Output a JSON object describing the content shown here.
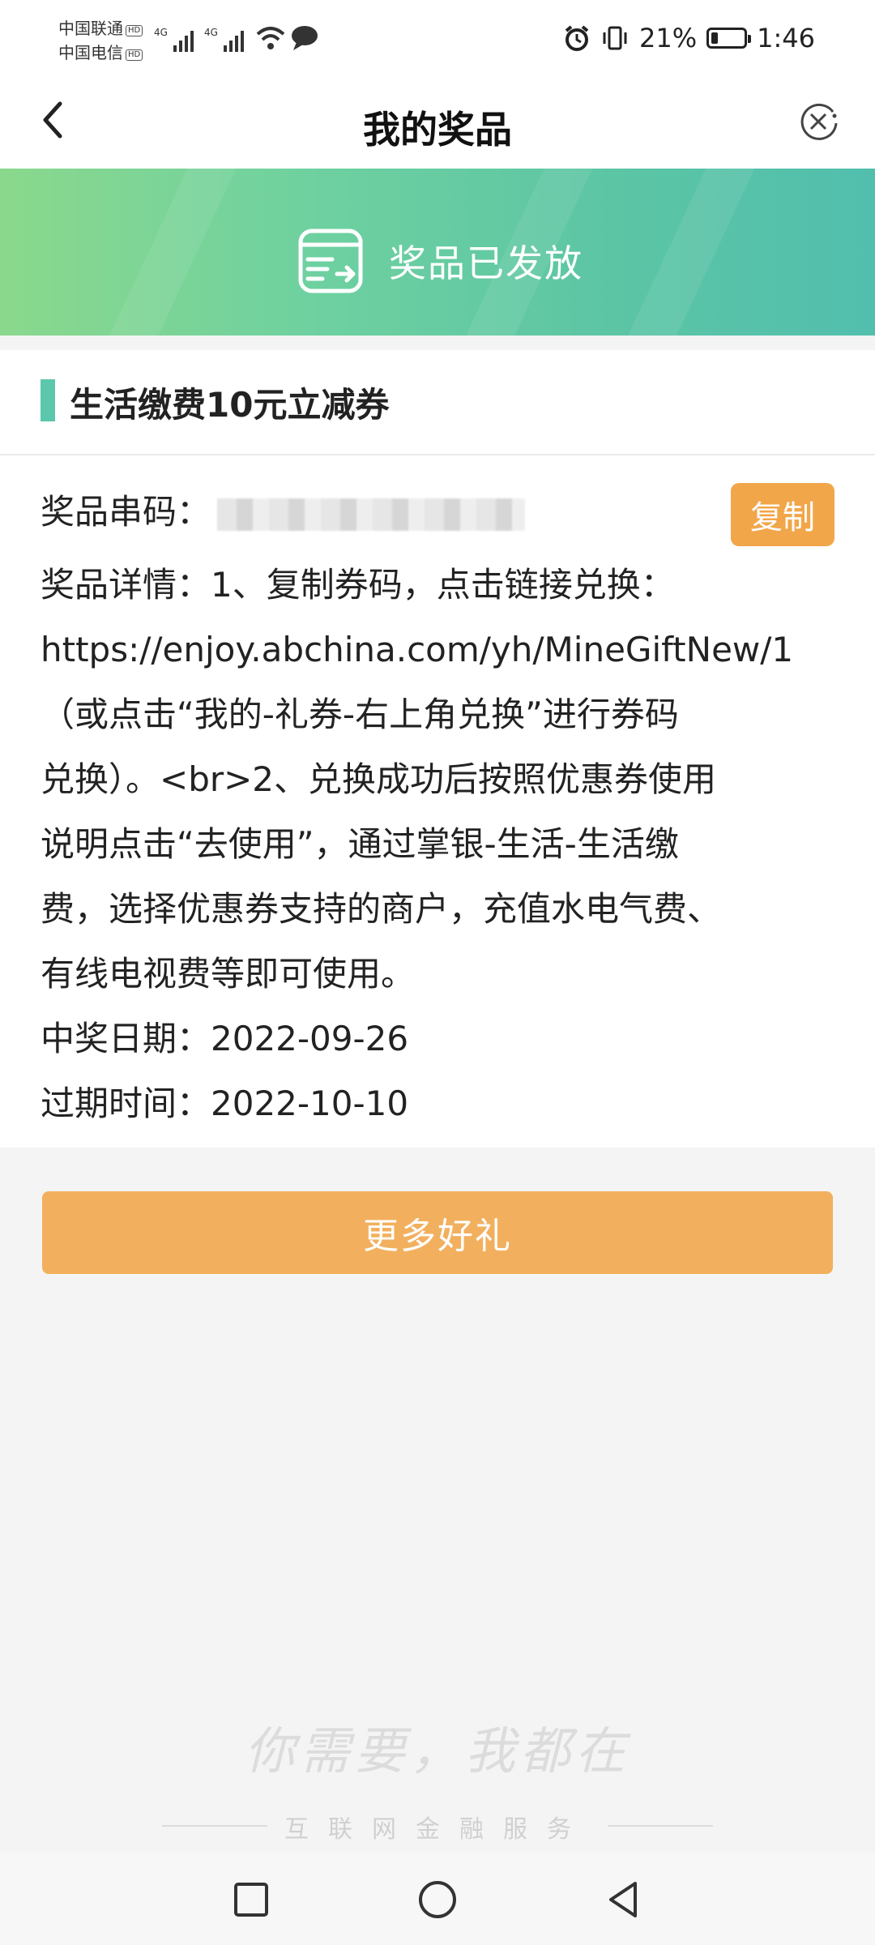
{
  "status_bar": {
    "carrier_1": "中国联通",
    "carrier_2": "中国电信",
    "hd_badge": "HD",
    "network": "4G",
    "battery_percent_text": "21%",
    "battery_level": 0.21,
    "time": "1:46"
  },
  "nav": {
    "title": "我的奖品"
  },
  "banner": {
    "text": "奖品已发放"
  },
  "prize": {
    "name": "生活缴费10元立减券",
    "serial_label": "奖品串码：",
    "copy_label": "复制",
    "details_lines": [
      "奖品详情：1、复制券码，点击链接兑换：",
      "https://enjoy.abchina.com/yh/MineGiftNew/1",
      "（或点击“我的-礼券-右上角兑换”进行券码",
      "兑换）。<br>2、兑换成功后按照优惠券使用",
      "说明点击“去使用”，通过掌银-生活-生活缴",
      "费，选择优惠券支持的商户，充值水电气费、",
      "有线电视费等即可使用。"
    ],
    "win_date_label": "中奖日期：",
    "win_date": "2022-09-26",
    "expire_label": "过期时间：",
    "expire_date": "2022-10-10"
  },
  "more_button": "更多好礼",
  "footer": {
    "slogan": "你需要，我都在",
    "tagline": "互联网金融服务"
  },
  "colors": {
    "accent_green": "#5cc7ad",
    "button_orange": "#f2b05e",
    "copy_orange": "#f2a64a"
  }
}
